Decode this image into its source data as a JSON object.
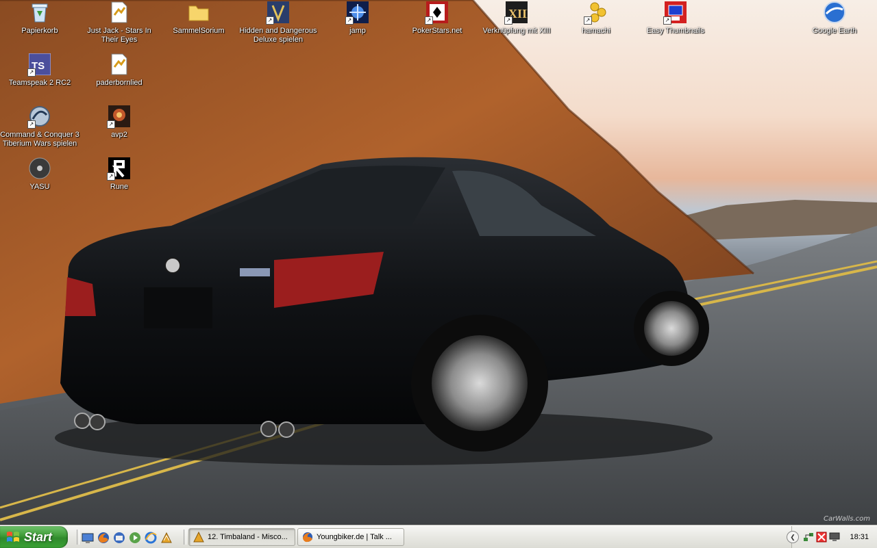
{
  "desktop": {
    "icons": [
      {
        "label": "Papierkorb",
        "icon": "recycle-bin-icon"
      },
      {
        "label": "Just Jack - Stars In Their Eyes",
        "icon": "media-file-icon"
      },
      {
        "label": "SammelSorium",
        "icon": "folder-icon"
      },
      {
        "label": "Hidden and Dangerous Deluxe spielen",
        "icon": "game-shortcut-icon"
      },
      {
        "label": "jamp",
        "icon": "game-shortcut-icon"
      },
      {
        "label": "PokerStars.net",
        "icon": "poker-icon"
      },
      {
        "label": "Verknüpfung mit XIII",
        "icon": "game-shortcut-icon"
      },
      {
        "label": "hamachi",
        "icon": "hamachi-icon"
      },
      {
        "label": "Easy Thumbnails",
        "icon": "thumbnails-icon"
      },
      {
        "label": "Google Earth",
        "icon": "globe-icon"
      },
      {
        "label": "Teamspeak 2 RC2",
        "icon": "teamspeak-icon"
      },
      {
        "label": "paderbornlied",
        "icon": "media-file-icon"
      },
      {
        "label": "Command & Conquer 3 Tiberium Wars spielen",
        "icon": "game-shortcut-icon"
      },
      {
        "label": "avp2",
        "icon": "game-shortcut-icon"
      },
      {
        "label": "YASU",
        "icon": "disc-icon"
      },
      {
        "label": "Rune",
        "icon": "rune-icon"
      }
    ],
    "watermark": "CarWalls.com"
  },
  "taskbar": {
    "start_label": "Start",
    "quick_launch": [
      "desktop-icon",
      "firefox-icon",
      "thunderbird-icon",
      "media-player-icon",
      "internet-explorer-icon",
      "winamp-icon"
    ],
    "tasks": [
      {
        "label": "12. Timbaland - Misco...",
        "icon": "winamp-icon",
        "active": true
      },
      {
        "label": "Youngbiker.de | Talk ...",
        "icon": "firefox-icon",
        "active": false
      }
    ],
    "tray_icons": [
      "network-icon",
      "antivirus-icon",
      "monitor-icon"
    ],
    "clock": "18:31"
  },
  "colors": {
    "start_green": "#3d9a37",
    "taskbar_silver": "#e9e9e4"
  }
}
